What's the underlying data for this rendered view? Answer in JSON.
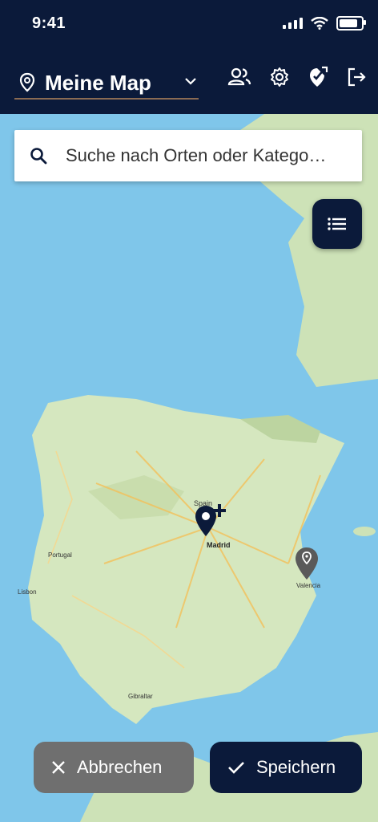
{
  "status": {
    "time": "9:41"
  },
  "header": {
    "map_title": "Meine Map",
    "icons": [
      "location-pin-icon",
      "chevron-down-icon",
      "users-icon",
      "settings-gear-icon",
      "tag-edit-icon",
      "logout-icon"
    ]
  },
  "search": {
    "placeholder": "Suche nach Orten oder Katego…"
  },
  "map": {
    "labels": {
      "madrid": "Madrid",
      "spain": "Spain",
      "valencia": "Valencia",
      "lisbon": "Lisbon",
      "portugal": "Portugal",
      "gibraltar": "Gibraltar"
    },
    "markers": [
      "add-place-marker",
      "place-marker-valencia"
    ]
  },
  "actions": {
    "cancel_label": "Abbrechen",
    "save_label": "Speichern"
  },
  "colors": {
    "header_bg": "#0b1a3a",
    "cancel_bg": "#6f6f6f",
    "save_bg": "#0b1a3a",
    "sea": "#7fc6ea",
    "land": "#cde2b7"
  }
}
